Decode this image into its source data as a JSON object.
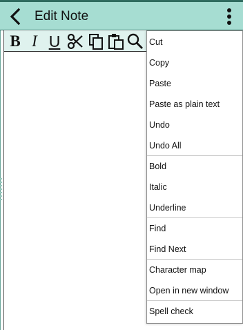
{
  "app": {
    "title": "Edit Note"
  },
  "colors": {
    "appbar": "#a6ddd2",
    "toolbar": "#dff2ee",
    "accent_dark": "#2f6b5f"
  },
  "icons": {
    "back": "back-arrow-icon",
    "more": "more-vertical-icon",
    "bold": "B",
    "italic": "I",
    "underline": "U",
    "cut": "scissors-icon",
    "copy": "copy-icon",
    "paste": "paste-icon",
    "find": "search-icon"
  },
  "context_menu": {
    "groups": [
      [
        "Cut",
        "Copy",
        "Paste",
        "Paste as plain text",
        "Undo",
        "Undo All"
      ],
      [
        "Bold",
        "Italic",
        "Underline"
      ],
      [
        "Find",
        "Find Next"
      ],
      [
        "Character map",
        "Open in new window"
      ],
      [
        "Spell check"
      ]
    ]
  }
}
